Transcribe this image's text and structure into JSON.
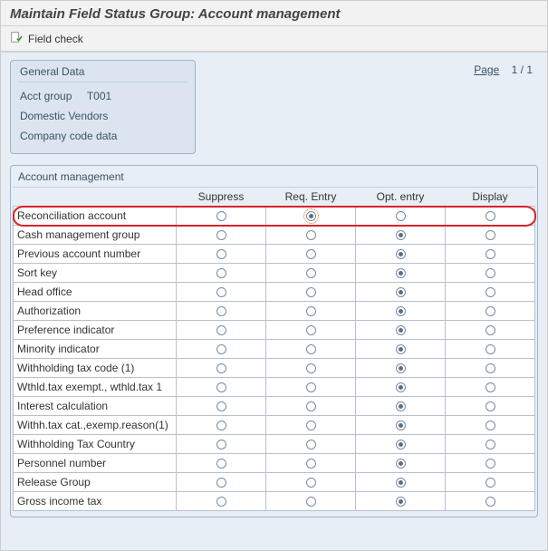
{
  "header": {
    "title": "Maintain Field Status Group: Account management"
  },
  "toolbar": {
    "field_check_label": "Field check"
  },
  "general": {
    "panel_title": "General Data",
    "acct_group_label": "Acct group",
    "acct_group_value": "T001",
    "line2": "Domestic Vendors",
    "line3": "Company code data"
  },
  "page_info": {
    "label": "Page",
    "current": "1",
    "sep": "/",
    "total": "1"
  },
  "table": {
    "title": "Account management",
    "cols": {
      "suppress": "Suppress",
      "req": "Req. Entry",
      "opt": "Opt. entry",
      "display": "Display"
    },
    "rows": [
      {
        "label": "Reconciliation account",
        "sel": "req",
        "highlight": true
      },
      {
        "label": "Cash management group",
        "sel": "opt"
      },
      {
        "label": "Previous account number",
        "sel": "opt"
      },
      {
        "label": "Sort key",
        "sel": "opt"
      },
      {
        "label": "Head office",
        "sel": "opt"
      },
      {
        "label": "Authorization",
        "sel": "opt"
      },
      {
        "label": "Preference indicator",
        "sel": "opt"
      },
      {
        "label": "Minority indicator",
        "sel": "opt"
      },
      {
        "label": "Withholding tax code (1)",
        "sel": "opt"
      },
      {
        "label": "Wthld.tax exempt., wthld.tax 1",
        "sel": "opt"
      },
      {
        "label": "Interest calculation",
        "sel": "opt"
      },
      {
        "label": "Withh.tax cat.,exemp.reason(1)",
        "sel": "opt"
      },
      {
        "label": "Withholding Tax Country",
        "sel": "opt"
      },
      {
        "label": "Personnel number",
        "sel": "opt"
      },
      {
        "label": "Release Group",
        "sel": "opt"
      },
      {
        "label": "Gross income tax",
        "sel": "opt"
      }
    ]
  },
  "columns_order": [
    "suppress",
    "req",
    "opt",
    "display"
  ]
}
